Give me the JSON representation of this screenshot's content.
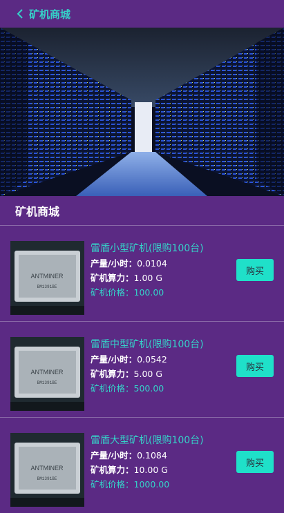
{
  "header": {
    "title": "矿机商城"
  },
  "section": {
    "title": "矿机商城"
  },
  "products": [
    {
      "name": "雷盾小型矿机(限购100台)",
      "output_label": "产量/小时：",
      "output_value": "0.0104",
      "power_label": "矿机算力：",
      "power_value": "1.00 G",
      "price_label": "矿机价格：",
      "price_value": "100.00",
      "buy_label": "购买"
    },
    {
      "name": "雷盾中型矿机(限购100台)",
      "output_label": "产量/小时：",
      "output_value": "0.0542",
      "power_label": "矿机算力：",
      "power_value": "5.00 G",
      "price_label": "矿机价格：",
      "price_value": "500.00",
      "buy_label": "购买"
    },
    {
      "name": "雷盾大型矿机(限购100台)",
      "output_label": "产量/小时：",
      "output_value": "0.1084",
      "power_label": "矿机算力：",
      "power_value": "10.00 G",
      "price_label": "矿机价格：",
      "price_value": "1000.00",
      "buy_label": "购买"
    }
  ],
  "thumb_text": {
    "brand": "ANTMINER",
    "model": "BM1391BE"
  },
  "colors": {
    "background": "#5b2a84",
    "accent": "#35d3c9",
    "button": "#1fe0c9"
  }
}
